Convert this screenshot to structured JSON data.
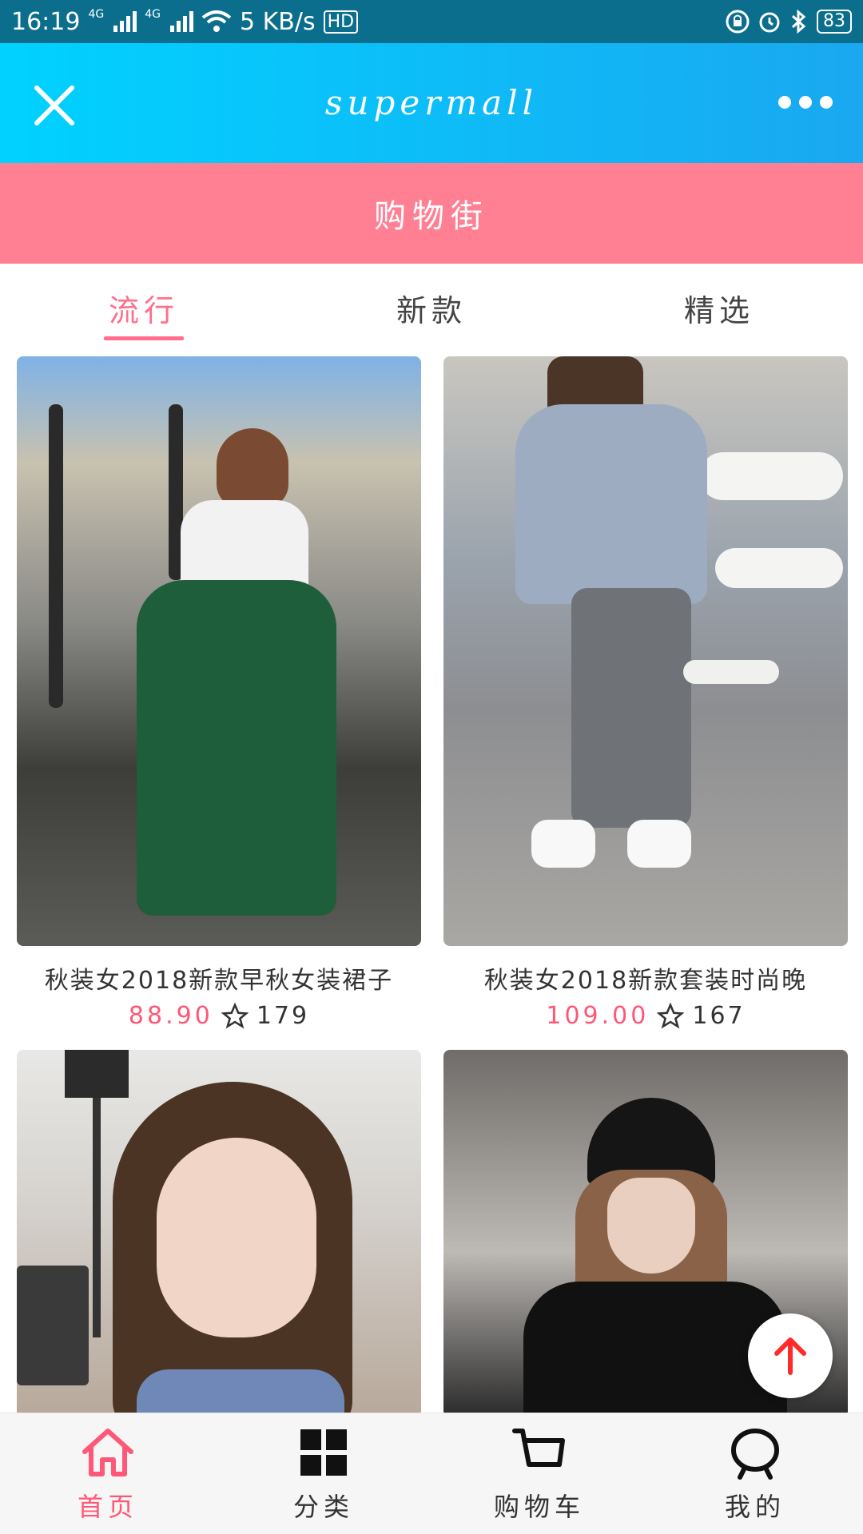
{
  "status_bar": {
    "time": "16:19",
    "network_1": "4G",
    "network_2": "4G",
    "speed": "5 KB/s",
    "hd": "HD",
    "battery": "83"
  },
  "titlebar": {
    "title": "supermall"
  },
  "navbar": {
    "title": "购物街"
  },
  "tabs": [
    {
      "label": "流行",
      "active": true
    },
    {
      "label": "新款",
      "active": false
    },
    {
      "label": "精选",
      "active": false
    }
  ],
  "goods": [
    {
      "title": "秋装女2018新款早秋女装裙子",
      "price": "88.90",
      "collect": "179"
    },
    {
      "title": "秋装女2018新款套装时尚晚",
      "price": "109.00",
      "collect": "167"
    },
    {
      "title": "",
      "price": "",
      "collect": ""
    },
    {
      "title": "",
      "price": "",
      "collect": ""
    }
  ],
  "tabbar": [
    {
      "label": "首页",
      "icon": "home-icon",
      "active": true
    },
    {
      "label": "分类",
      "icon": "category-icon",
      "active": false
    },
    {
      "label": "购物车",
      "icon": "cart-icon",
      "active": false
    },
    {
      "label": "我的",
      "icon": "profile-icon",
      "active": false
    }
  ],
  "colors": {
    "accent": "#ff5777",
    "navbar": "#ff7f93",
    "titlebar": "#1aa8f0"
  }
}
